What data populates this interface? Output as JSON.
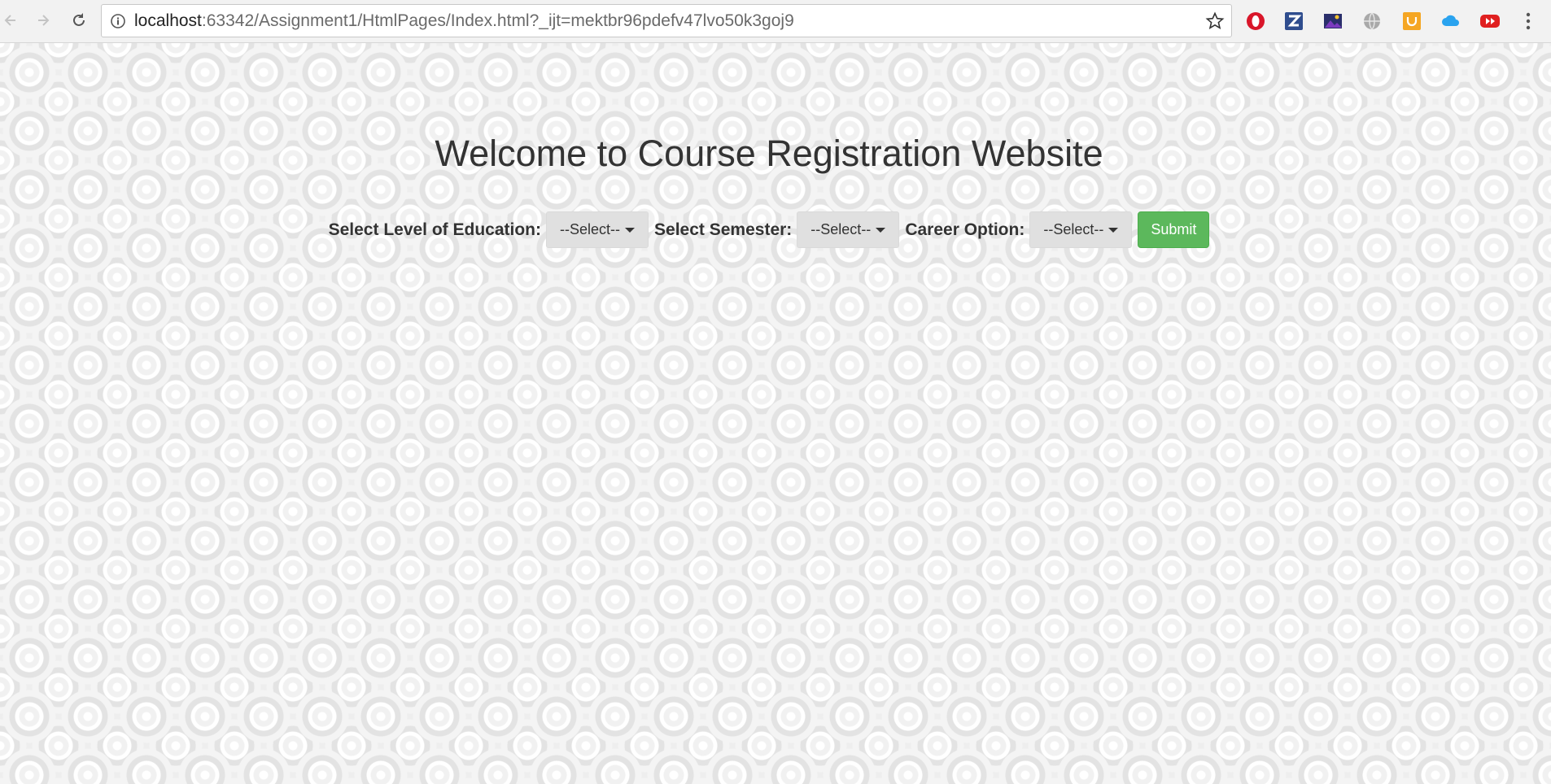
{
  "browser": {
    "url_host": "localhost",
    "url_rest": ":63342/Assignment1/HtmlPages/Index.html?_ijt=mektbr96pdefv47lvo50k3goj9",
    "extensions": [
      "opera-icon",
      "zotero-icon",
      "photo-icon",
      "globe-icon",
      "honey-icon",
      "cloud-icon",
      "youtube-icon"
    ]
  },
  "page": {
    "heading": "Welcome to Course Registration Website",
    "education_label": "Select Level of Education:",
    "education_select": "--Select--",
    "semester_label": "Select Semester:",
    "semester_select": "--Select--",
    "career_label": "Career Option:",
    "career_select": "--Select--",
    "submit_label": "Submit"
  },
  "colors": {
    "submit": "#5cb85c",
    "dropdown": "#e0e0e0"
  }
}
